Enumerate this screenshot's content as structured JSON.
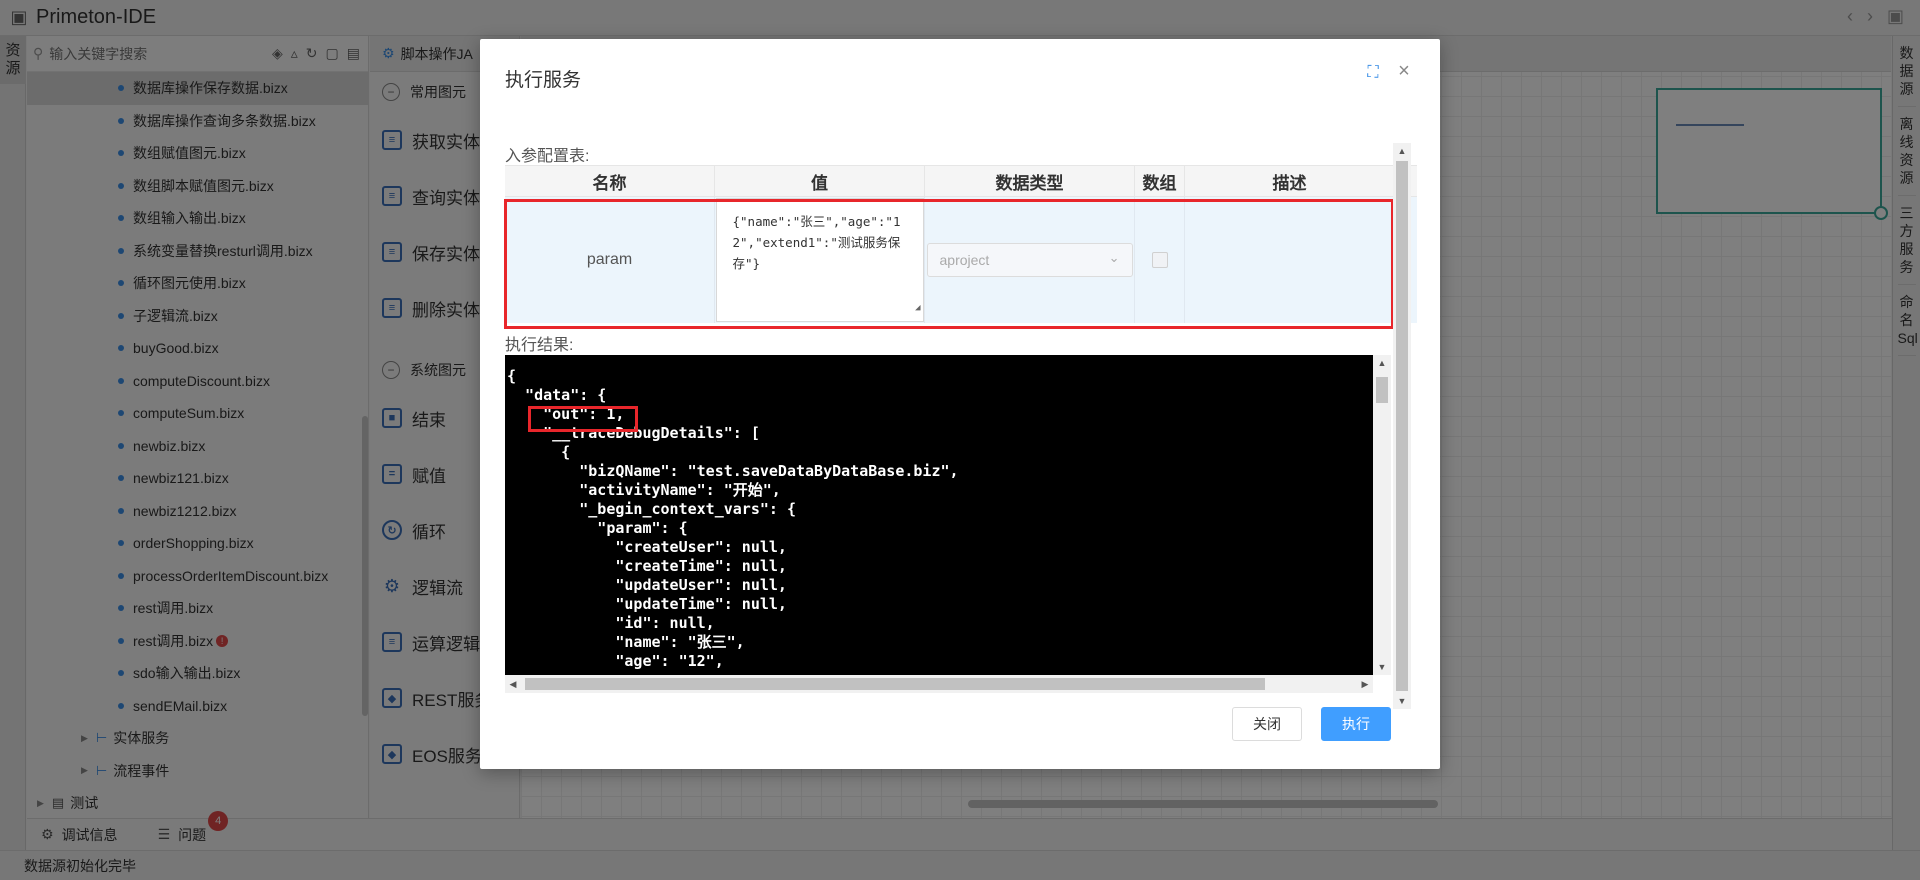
{
  "app": {
    "title": "Primeton-IDE"
  },
  "left_strip": {
    "resource_tab": "资源"
  },
  "tree": {
    "search_placeholder": "输入关键字搜索",
    "files": [
      "数据库操作保存数据.bizx",
      "数据库操作查询多条数据.bizx",
      "数组赋值图元.bizx",
      "数组脚本赋值图元.bizx",
      "数组输入输出.bizx",
      "系统变量替换resturl调用.bizx",
      "循环图元使用.bizx",
      "子逻辑流.bizx",
      "buyGood.bizx",
      "computeDiscount.bizx",
      "computeSum.bizx",
      "newbiz.bizx",
      "newbiz121.bizx",
      "newbiz1212.bizx",
      "orderShopping.bizx",
      "processOrderItemDiscount.bizx",
      "rest调用.bizx",
      "rest调用.bizx",
      "sdo输入输出.bizx",
      "sendEMail.bizx"
    ],
    "error_badge": "!",
    "folders": [
      "实体服务",
      "流程事件"
    ],
    "top_folder": "测试"
  },
  "palette": {
    "tab_label": "脚本操作JA",
    "section_common": "常用图元",
    "common_items": [
      "获取实体",
      "查询实体",
      "保存实体",
      "删除实体"
    ],
    "section_system": "系统图元",
    "system_items": [
      "结束",
      "赋值",
      "循环",
      "逻辑流",
      "运算逻辑",
      "REST服务",
      "EOS服务"
    ]
  },
  "right_strip": {
    "tabs": [
      "数据源",
      "离线资源",
      "三方服务",
      "命名Sql"
    ]
  },
  "bottom": {
    "debug_tab": "调试信息",
    "problems_tab": "问题",
    "problems_count": "4",
    "status": "数据源初始化完毕"
  },
  "modal": {
    "title": "执行服务",
    "input_section": "入参配置表:",
    "columns": [
      "名称",
      "值",
      "数据类型",
      "数组",
      "描述"
    ],
    "row": {
      "name": "param",
      "value": "{\"name\":\"张三\",\"age\":\"12\",\"extend1\":\"测试服务保存\"}",
      "type_placeholder": "aproject",
      "description": ""
    },
    "result_section": "执行结果:",
    "result_lines": [
      "{",
      "  \"data\": {",
      "    \"out\": 1,",
      "    \"__traceDebugDetails\": [",
      "      {",
      "        \"bizQName\": \"test.saveDataByDataBase.biz\",",
      "        \"activityName\": \"开始\",",
      "        \"_begin_context_vars\": {",
      "          \"param\": {",
      "            \"createUser\": null,",
      "            \"createTime\": null,",
      "            \"updateUser\": null,",
      "            \"updateTime\": null,",
      "            \"id\": null,",
      "            \"name\": \"张三\",",
      "            \"age\": \"12\","
    ],
    "close_label": "关闭",
    "execute_label": "执行"
  },
  "colors": {
    "accent": "#409eff",
    "highlight": "#e8262b",
    "row_bg": "#ecf5fc"
  }
}
